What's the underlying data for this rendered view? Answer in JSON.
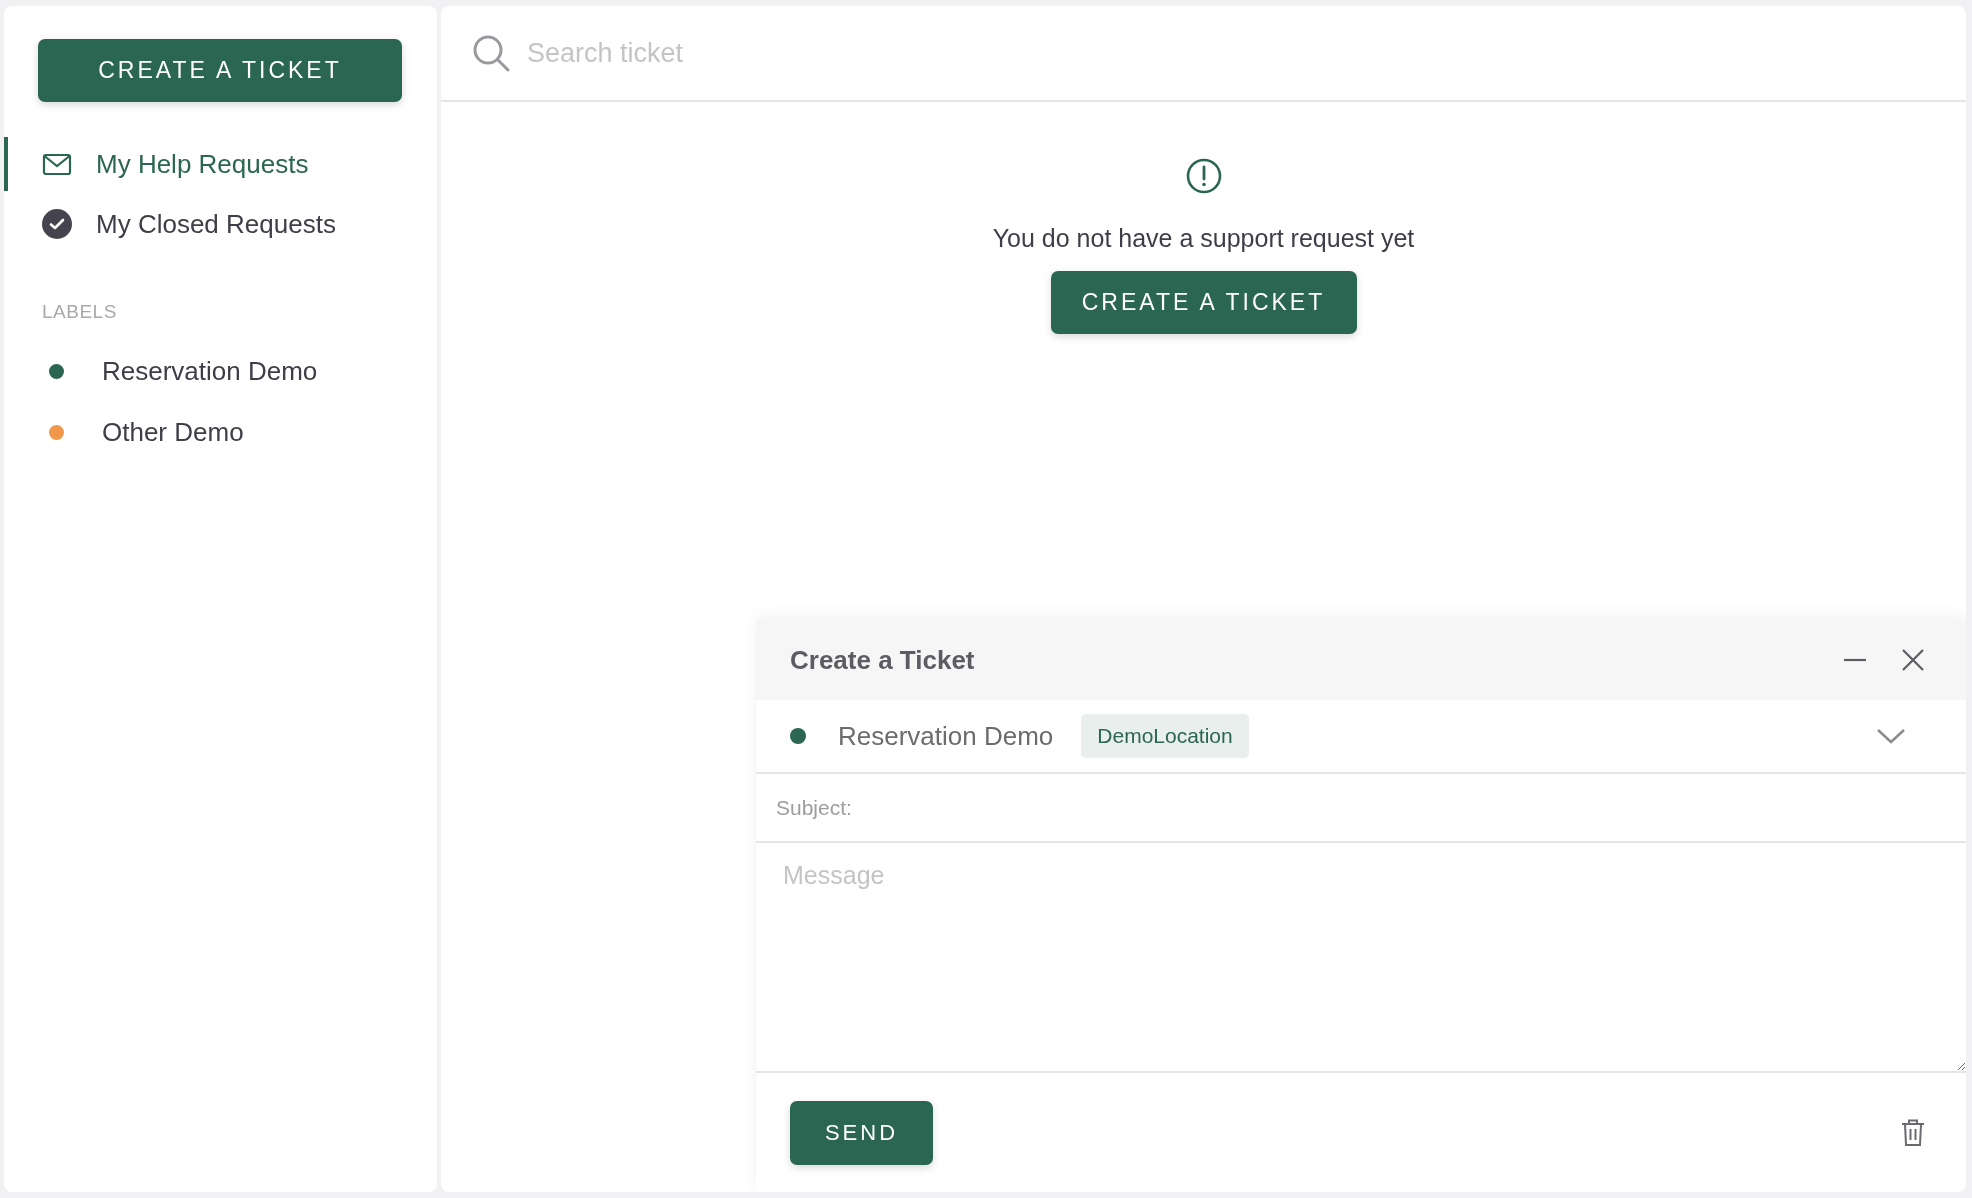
{
  "sidebar": {
    "create_button": "CREATE A TICKET",
    "nav_items": [
      {
        "label": "My Help Requests",
        "kind": "inbox",
        "selected": true
      },
      {
        "label": "My Closed Requests",
        "kind": "closed",
        "selected": false
      }
    ],
    "labels_heading": "LABELS",
    "labels": [
      {
        "name": "Reservation Demo",
        "color": "#2b6652"
      },
      {
        "name": "Other Demo",
        "color": "#f0974a"
      }
    ]
  },
  "search": {
    "placeholder": "Search ticket"
  },
  "empty_state": {
    "message": "You do not have a support request yet",
    "button": "CREATE A TICKET"
  },
  "compose": {
    "title": "Create a Ticket",
    "label": {
      "name": "Reservation Demo",
      "color": "#2b6652",
      "tag": "DemoLocation"
    },
    "subject_placeholder": "Subject:",
    "message_placeholder": "Message",
    "send_button": "SEND"
  }
}
